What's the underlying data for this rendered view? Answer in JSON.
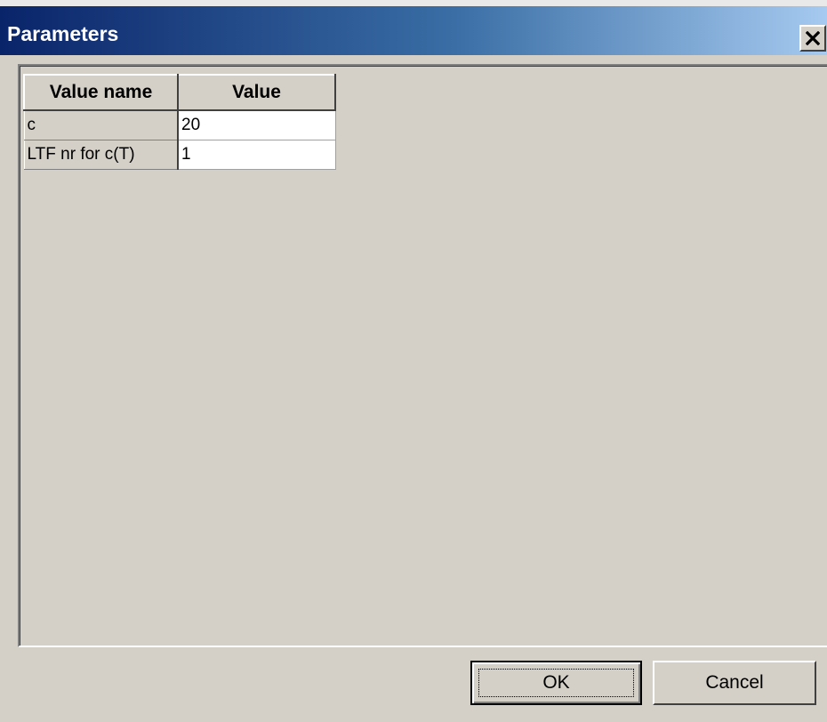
{
  "window": {
    "title": "Parameters",
    "close_icon": "close-icon"
  },
  "table": {
    "headers": [
      "Value name",
      "Value"
    ],
    "rows": [
      {
        "name": "c",
        "value": "20"
      },
      {
        "name": "LTF nr for c(T)",
        "value": "1"
      }
    ]
  },
  "buttons": {
    "ok_label": "OK",
    "cancel_label": "Cancel"
  },
  "colors": {
    "titlebar_start": "#0a246a",
    "titlebar_end": "#a6caf0",
    "face": "#d4d0c8"
  }
}
